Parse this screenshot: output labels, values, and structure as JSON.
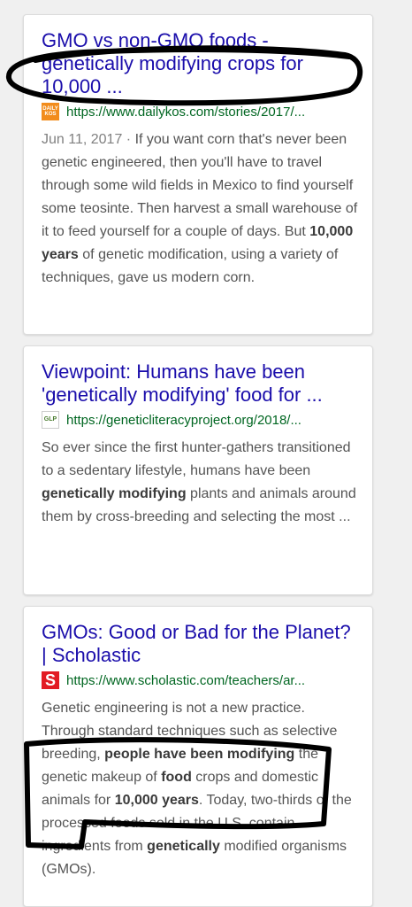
{
  "results": [
    {
      "title": "GMO vs non-GMO foods - genetically modifying crops for 10,000 ...",
      "favicon": "DAILY KOS",
      "url": "https://www.dailykos.com/stories/2017/...",
      "date": "Jun 11, 2017",
      "separator": " · ",
      "snippet_parts": [
        {
          "text": "If you want corn that's never been genetic engineered, then you'll have to travel through some wild fields in Mexico to find yourself some teosinte. Then harvest a small warehouse of it to feed yourself for a couple of days. But ",
          "bold": false
        },
        {
          "text": "10,000 years",
          "bold": true
        },
        {
          "text": " of genetic modification, using a variety of techniques, gave us modern corn.",
          "bold": false
        }
      ]
    },
    {
      "title": "Viewpoint: Humans have been 'genetically modifying' food for ...",
      "favicon": "GLP",
      "url": "https://geneticliteracyproject.org/2018/...",
      "snippet_parts": [
        {
          "text": "So ever since the first hunter-gathers transitioned to a sedentary lifestyle, humans have been ",
          "bold": false
        },
        {
          "text": "genetically modifying",
          "bold": true
        },
        {
          "text": " plants and animals around them by cross-breeding and selecting the most ...",
          "bold": false
        }
      ]
    },
    {
      "title": "GMOs: Good or Bad for the Planet? | Scholastic",
      "favicon": "S",
      "url": "https://www.scholastic.com/teachers/ar...",
      "snippet_parts": [
        {
          "text": "Genetic engineering is not a new practice. Through standard techniques such as selective breeding, ",
          "bold": false
        },
        {
          "text": "people have been modifying",
          "bold": true
        },
        {
          "text": " the genetic makeup of ",
          "bold": false
        },
        {
          "text": "food",
          "bold": true
        },
        {
          "text": " crops and domestic animals for ",
          "bold": false
        },
        {
          "text": "10,000 years",
          "bold": true
        },
        {
          "text": ". Today, two-thirds of the processed foods sold in the U.S. contain ingredients from ",
          "bold": false
        },
        {
          "text": "genetically",
          "bold": true
        },
        {
          "text": " modified organisms (GMOs).",
          "bold": false
        }
      ]
    }
  ]
}
